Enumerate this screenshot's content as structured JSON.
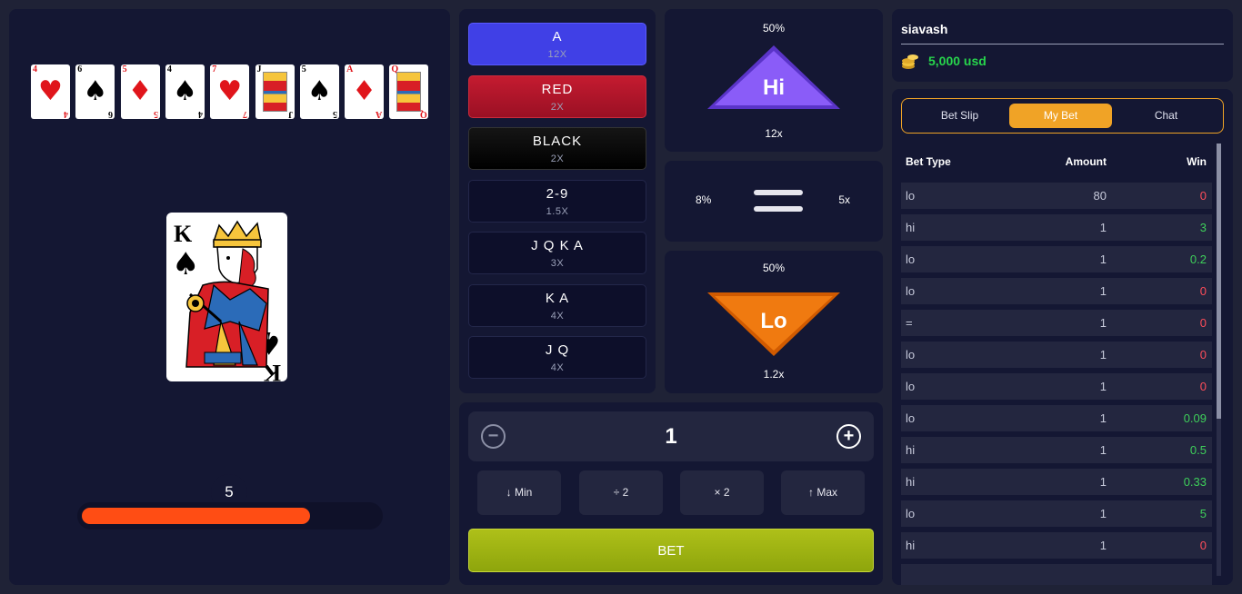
{
  "history_cards": [
    {
      "rank": "4",
      "suit": "♥",
      "color": "red"
    },
    {
      "rank": "6",
      "suit": "♠",
      "color": "black"
    },
    {
      "rank": "5",
      "suit": "♦",
      "color": "red"
    },
    {
      "rank": "4",
      "suit": "♠",
      "color": "black"
    },
    {
      "rank": "7",
      "suit": "♥",
      "color": "red"
    },
    {
      "rank": "J",
      "suit": "♠",
      "color": "black",
      "face": true
    },
    {
      "rank": "5",
      "suit": "♠",
      "color": "black"
    },
    {
      "rank": "A",
      "suit": "♦",
      "color": "red"
    },
    {
      "rank": "Q",
      "suit": "♥",
      "color": "red",
      "face": true
    }
  ],
  "current_card": {
    "rank": "K",
    "suit": "♠"
  },
  "counter": "5",
  "timer_progress": 0.77,
  "bet_options": {
    "a": {
      "label": "A",
      "mult": "12X"
    },
    "red": {
      "label": "RED",
      "mult": "2X"
    },
    "black": {
      "label": "BLACK",
      "mult": "2X"
    },
    "r29": {
      "label": "2-9",
      "mult": "1.5X"
    },
    "jqka": {
      "label": "J Q K A",
      "mult": "3X"
    },
    "ka": {
      "label": "K A",
      "mult": "4X"
    },
    "jq": {
      "label": "J Q",
      "mult": "4X"
    }
  },
  "hi": {
    "percent": "50%",
    "label": "Hi",
    "mult": "12x",
    "color": "#7b4cf0"
  },
  "equal": {
    "percent": "8%",
    "mult": "5x"
  },
  "lo": {
    "percent": "50%",
    "label": "Lo",
    "mult": "1.2x",
    "color": "#f07a10"
  },
  "controls": {
    "amount": "1",
    "minus": "−",
    "plus": "+",
    "min_label": "↓  Min",
    "half_label": "÷ 2",
    "double_label": "× 2",
    "max_label": "↑  Max",
    "bet_label": "BET"
  },
  "user": {
    "name": "siavash",
    "balance": "5,000 usd"
  },
  "tabs": {
    "bet_slip": "Bet Slip",
    "my_bet": "My Bet",
    "chat": "Chat"
  },
  "table": {
    "headers": {
      "type": "Bet Type",
      "amount": "Amount",
      "win": "Win"
    },
    "rows": [
      {
        "type": "lo",
        "amount": "80",
        "win": "0"
      },
      {
        "type": "hi",
        "amount": "1",
        "win": "3"
      },
      {
        "type": "lo",
        "amount": "1",
        "win": "0.2"
      },
      {
        "type": "lo",
        "amount": "1",
        "win": "0"
      },
      {
        "type": "=",
        "amount": "1",
        "win": "0"
      },
      {
        "type": "lo",
        "amount": "1",
        "win": "0"
      },
      {
        "type": "lo",
        "amount": "1",
        "win": "0"
      },
      {
        "type": "lo",
        "amount": "1",
        "win": "0.09"
      },
      {
        "type": "hi",
        "amount": "1",
        "win": "0.5"
      },
      {
        "type": "hi",
        "amount": "1",
        "win": "0.33"
      },
      {
        "type": "lo",
        "amount": "1",
        "win": "5"
      },
      {
        "type": "hi",
        "amount": "1",
        "win": "0"
      },
      {
        "type": "",
        "amount": "",
        "win": ""
      }
    ]
  }
}
